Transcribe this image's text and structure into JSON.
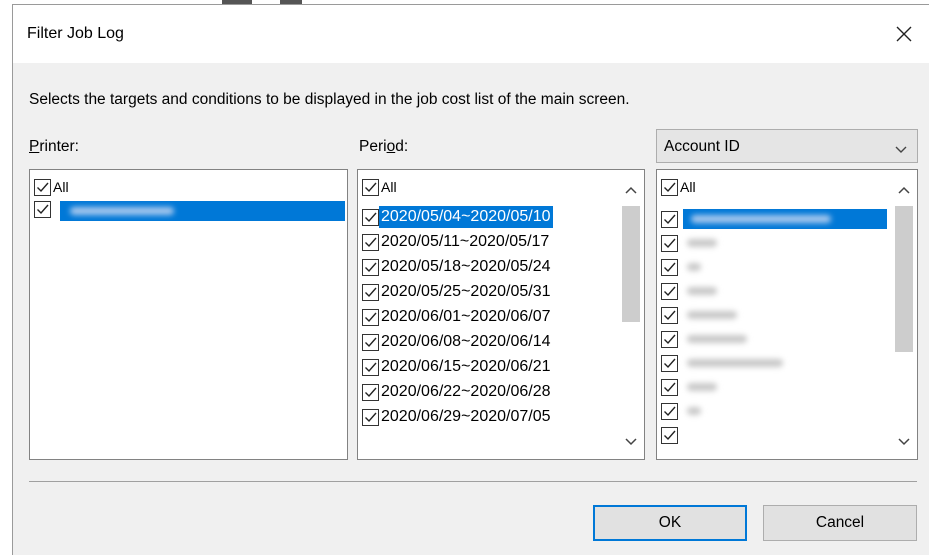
{
  "dialog": {
    "title": "Filter Job Log",
    "close_icon": "close-icon",
    "description": "Selects the targets and conditions to be displayed in the job cost list of the main screen."
  },
  "printer": {
    "label_prefix": "",
    "label_mnemonic": "P",
    "label_rest": "rinter:",
    "items": [
      {
        "label": "All",
        "checked": true,
        "selected": false
      }
    ],
    "redacted_rows": 1
  },
  "period": {
    "label_prefix": "Peri",
    "label_mnemonic": "o",
    "label_rest": "d:",
    "items": [
      {
        "label": "All",
        "checked": true
      },
      {
        "label": "2020/05/04~2020/05/10",
        "checked": true,
        "selected": true
      },
      {
        "label": "2020/05/11~2020/05/17",
        "checked": true
      },
      {
        "label": "2020/05/18~2020/05/24",
        "checked": true
      },
      {
        "label": "2020/05/25~2020/05/31",
        "checked": true
      },
      {
        "label": "2020/06/01~2020/06/07",
        "checked": true
      },
      {
        "label": "2020/06/08~2020/06/14",
        "checked": true
      },
      {
        "label": "2020/06/15~2020/06/21",
        "checked": true
      },
      {
        "label": "2020/06/22~2020/06/28",
        "checked": true
      },
      {
        "label": "2020/06/29~2020/07/05",
        "checked": true
      }
    ]
  },
  "account": {
    "dropdown_value": "Account ID",
    "items": [
      {
        "label": "All",
        "checked": true
      }
    ],
    "redacted_rows": 10
  },
  "buttons": {
    "ok": "OK",
    "cancel": "Cancel"
  },
  "colors": {
    "selection": "#0078d7",
    "dialog_bg": "#f0f0f0",
    "list_bg": "#ffffff"
  }
}
